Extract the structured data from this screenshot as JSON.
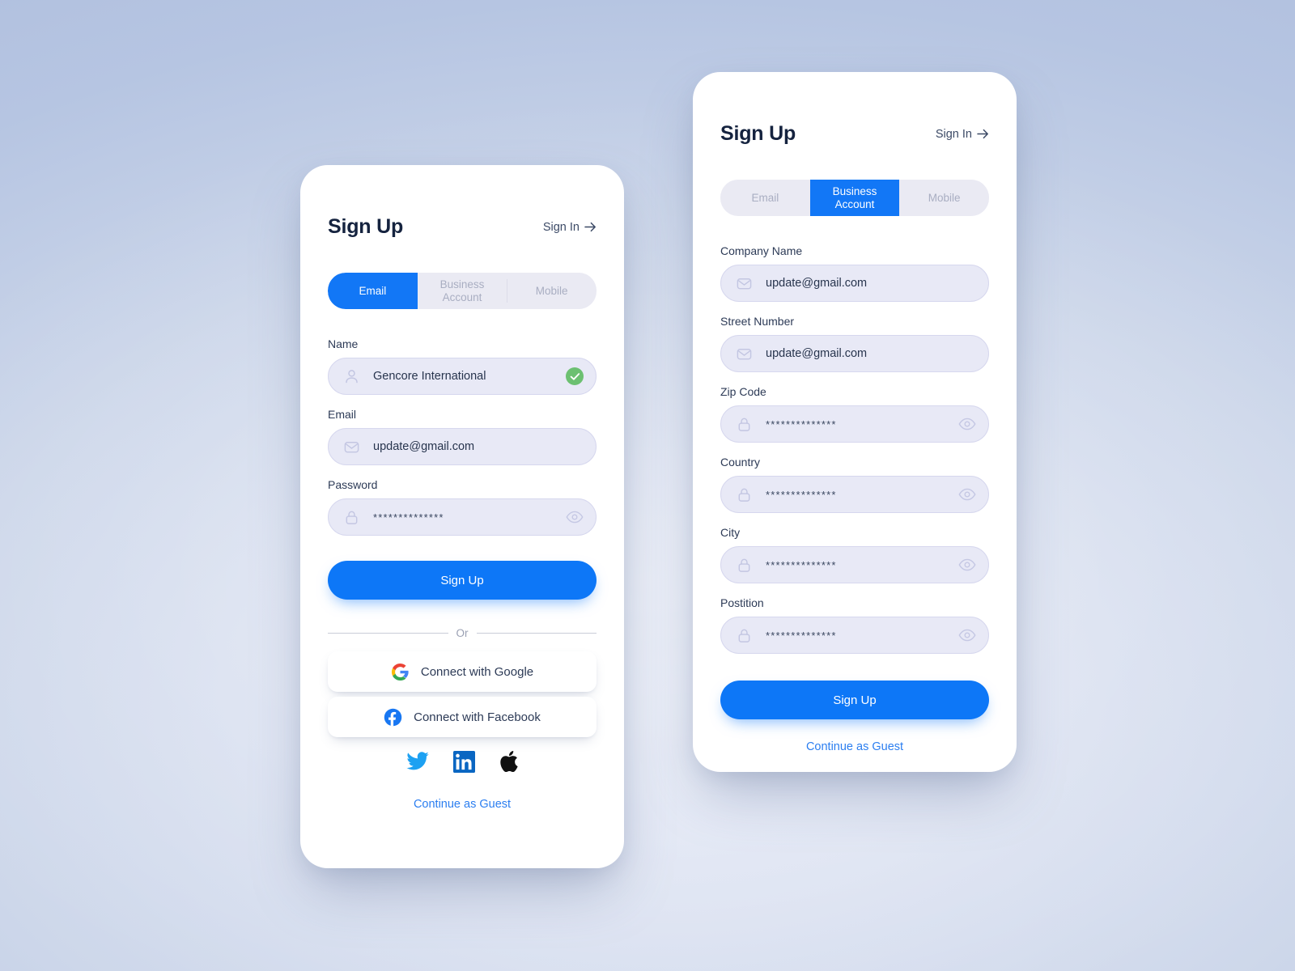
{
  "background": {
    "gradient_from": "#aabada",
    "gradient_to": "#e4e9f6"
  },
  "theme": {
    "accent_blue": "#0d77f7",
    "tab_active_blue": "#1277f6",
    "field_fill": "#e8e9f6",
    "field_border": "#d6d7ee",
    "label_color": "#2c3a56",
    "success_green": "#6cc071",
    "link_blue": "#2b7ef0",
    "card_white": "#ffffff"
  },
  "left_card": {
    "header": {
      "title": "Sign Up",
      "signin_label": "Sign In",
      "signin_icon": "arrow-right-icon"
    },
    "tabs": [
      {
        "label": "Email",
        "active": true
      },
      {
        "label": "Business\nAccount",
        "active": false
      },
      {
        "label": "Mobile",
        "active": false
      }
    ],
    "fields": [
      {
        "label": "Name",
        "value": "Gencore International",
        "lead_icon": "user-icon",
        "trail_icon": "check-circle-icon",
        "masked": false
      },
      {
        "label": "Email",
        "value": "update@gmail.com",
        "lead_icon": "mail-icon",
        "trail_icon": "none",
        "masked": false
      },
      {
        "label": "Password",
        "value": "**************",
        "lead_icon": "lock-icon",
        "trail_icon": "eye-icon",
        "masked": true
      }
    ],
    "submit_label": "Sign Up",
    "divider_label": "Or",
    "social_buttons": [
      {
        "label": "Connect with Google",
        "icon": "google-icon"
      },
      {
        "label": "Connect with Facebook",
        "icon": "facebook-icon"
      }
    ],
    "social_icons": [
      {
        "name": "twitter-icon",
        "color": "#1da1f2"
      },
      {
        "name": "linkedin-icon",
        "color": "#0a66c2"
      },
      {
        "name": "apple-icon",
        "color": "#111111"
      }
    ],
    "guest_label": "Continue as Guest"
  },
  "right_card": {
    "header": {
      "title": "Sign Up",
      "signin_label": "Sign In",
      "signin_icon": "arrow-right-icon"
    },
    "tabs": [
      {
        "label": "Email",
        "active": false
      },
      {
        "label": "Business\nAccount",
        "active": true
      },
      {
        "label": "Mobile",
        "active": false
      }
    ],
    "fields": [
      {
        "label": "Company Name",
        "value": "update@gmail.com",
        "lead_icon": "mail-icon",
        "trail_icon": "none",
        "masked": false
      },
      {
        "label": "Street Number",
        "value": "update@gmail.com",
        "lead_icon": "mail-icon",
        "trail_icon": "none",
        "masked": false
      },
      {
        "label": "Zip Code",
        "value": "**************",
        "lead_icon": "lock-icon",
        "trail_icon": "eye-icon",
        "masked": true
      },
      {
        "label": "Country",
        "value": "**************",
        "lead_icon": "lock-icon",
        "trail_icon": "eye-icon",
        "masked": true
      },
      {
        "label": "City",
        "value": "**************",
        "lead_icon": "lock-icon",
        "trail_icon": "eye-icon",
        "masked": true
      },
      {
        "label": "Postition",
        "value": "**************",
        "lead_icon": "lock-icon",
        "trail_icon": "eye-icon",
        "masked": true
      }
    ],
    "submit_label": "Sign Up",
    "guest_label": "Continue as Guest"
  }
}
